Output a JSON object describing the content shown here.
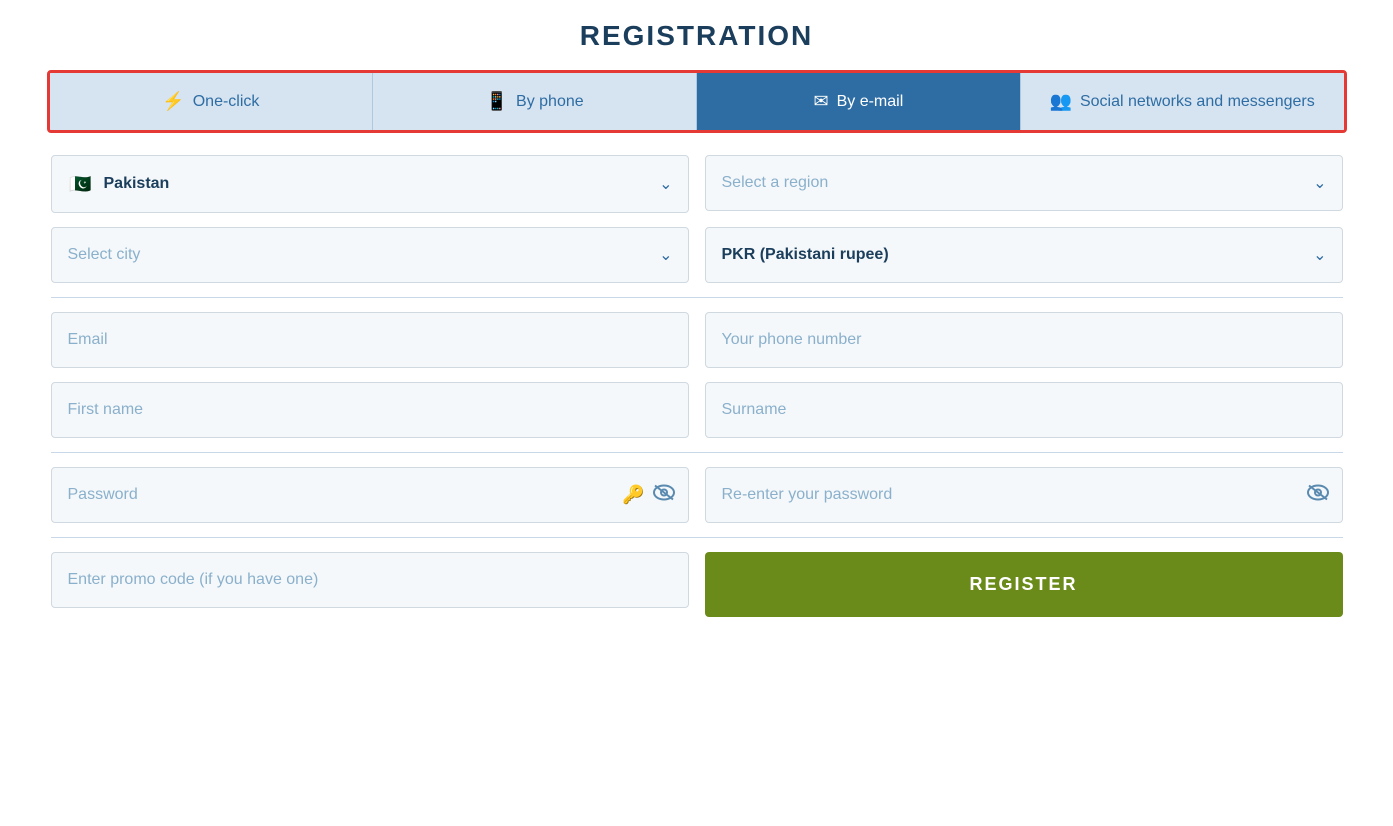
{
  "page": {
    "title": "REGISTRATION"
  },
  "tabs": [
    {
      "id": "one-click",
      "label": "One-click",
      "icon": "⚡",
      "active": false
    },
    {
      "id": "by-phone",
      "label": "By phone",
      "icon": "📱",
      "active": false
    },
    {
      "id": "by-email",
      "label": "By e-mail",
      "icon": "✉",
      "active": true
    },
    {
      "id": "social",
      "label": "Social networks and messengers",
      "icon": "👥",
      "active": false
    }
  ],
  "form": {
    "country": {
      "flag": "🇵🇰",
      "name": "Pakistan"
    },
    "region_placeholder": "Select a region",
    "city_placeholder": "Select city",
    "currency_value": "PKR (Pakistani rupee)",
    "email_placeholder": "Email",
    "phone_placeholder": "Your phone number",
    "firstname_placeholder": "First name",
    "surname_placeholder": "Surname",
    "password_placeholder": "Password",
    "reenter_password_placeholder": "Re-enter your password",
    "promo_placeholder": "Enter promo code (if you have one)",
    "register_label": "REGISTER"
  }
}
